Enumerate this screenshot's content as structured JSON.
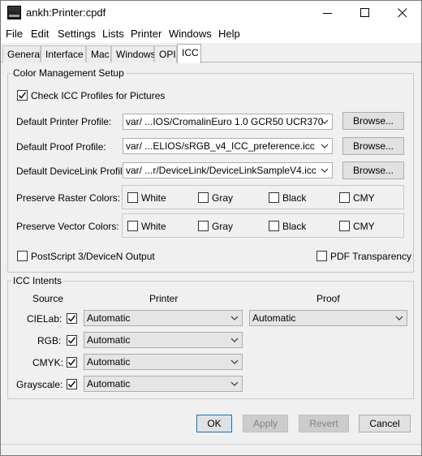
{
  "window": {
    "title": "ankh:Printer:cpdf"
  },
  "menu": [
    "File",
    "Edit",
    "Settings",
    "Lists",
    "Printer",
    "Windows",
    "Help"
  ],
  "tabs": [
    {
      "label": "General",
      "active": false
    },
    {
      "label": "Interface",
      "active": false
    },
    {
      "label": "Mac",
      "active": false
    },
    {
      "label": "Windows",
      "active": false
    },
    {
      "label": "OPI",
      "active": false
    },
    {
      "label": "ICC",
      "active": true
    }
  ],
  "color_management": {
    "title": "Color Management Setup",
    "check_icc": {
      "label": "Check ICC Profiles for Pictures",
      "checked": true
    },
    "printer_profile": {
      "label": "Default Printer Profile:",
      "value": "var/ ...IOS/CromalinEuro 1.0 GCR50 UCR370",
      "browse": "Browse..."
    },
    "proof_profile": {
      "label": "Default Proof Profile:",
      "value": "var/ ...ELIOS/sRGB_v4_ICC_preference.icc",
      "browse": "Browse..."
    },
    "devicelink_profile": {
      "label": "Default DeviceLink Profile:",
      "value": "var/ ...r/DeviceLink/DeviceLinkSampleV4.icc",
      "browse": "Browse..."
    },
    "raster": {
      "label": "Preserve Raster Colors:",
      "options": [
        {
          "label": "White",
          "checked": false
        },
        {
          "label": "Gray",
          "checked": false
        },
        {
          "label": "Black",
          "checked": false
        },
        {
          "label": "CMY",
          "checked": false
        }
      ]
    },
    "vector": {
      "label": "Preserve Vector Colors:",
      "options": [
        {
          "label": "White",
          "checked": false
        },
        {
          "label": "Gray",
          "checked": false
        },
        {
          "label": "Black",
          "checked": false
        },
        {
          "label": "CMY",
          "checked": false
        }
      ]
    },
    "postscript": {
      "label": "PostScript 3/DeviceN Output",
      "checked": false
    },
    "pdf_transparency": {
      "label": "PDF Transparency",
      "checked": false
    }
  },
  "intents": {
    "title": "ICC Intents",
    "headers": {
      "source": "Source",
      "printer": "Printer",
      "proof": "Proof"
    },
    "rows": [
      {
        "label": "CIELab:",
        "checked": true,
        "printer": "Automatic",
        "proof": "Automatic"
      },
      {
        "label": "RGB:",
        "checked": true,
        "printer": "Automatic"
      },
      {
        "label": "CMYK:",
        "checked": true,
        "printer": "Automatic"
      },
      {
        "label": "Grayscale:",
        "checked": true,
        "printer": "Automatic"
      }
    ]
  },
  "buttons": {
    "ok": "OK",
    "apply": "Apply",
    "revert": "Revert",
    "cancel": "Cancel"
  },
  "colors": {
    "accent": "#0078d7",
    "disabled_text": "#838383"
  }
}
